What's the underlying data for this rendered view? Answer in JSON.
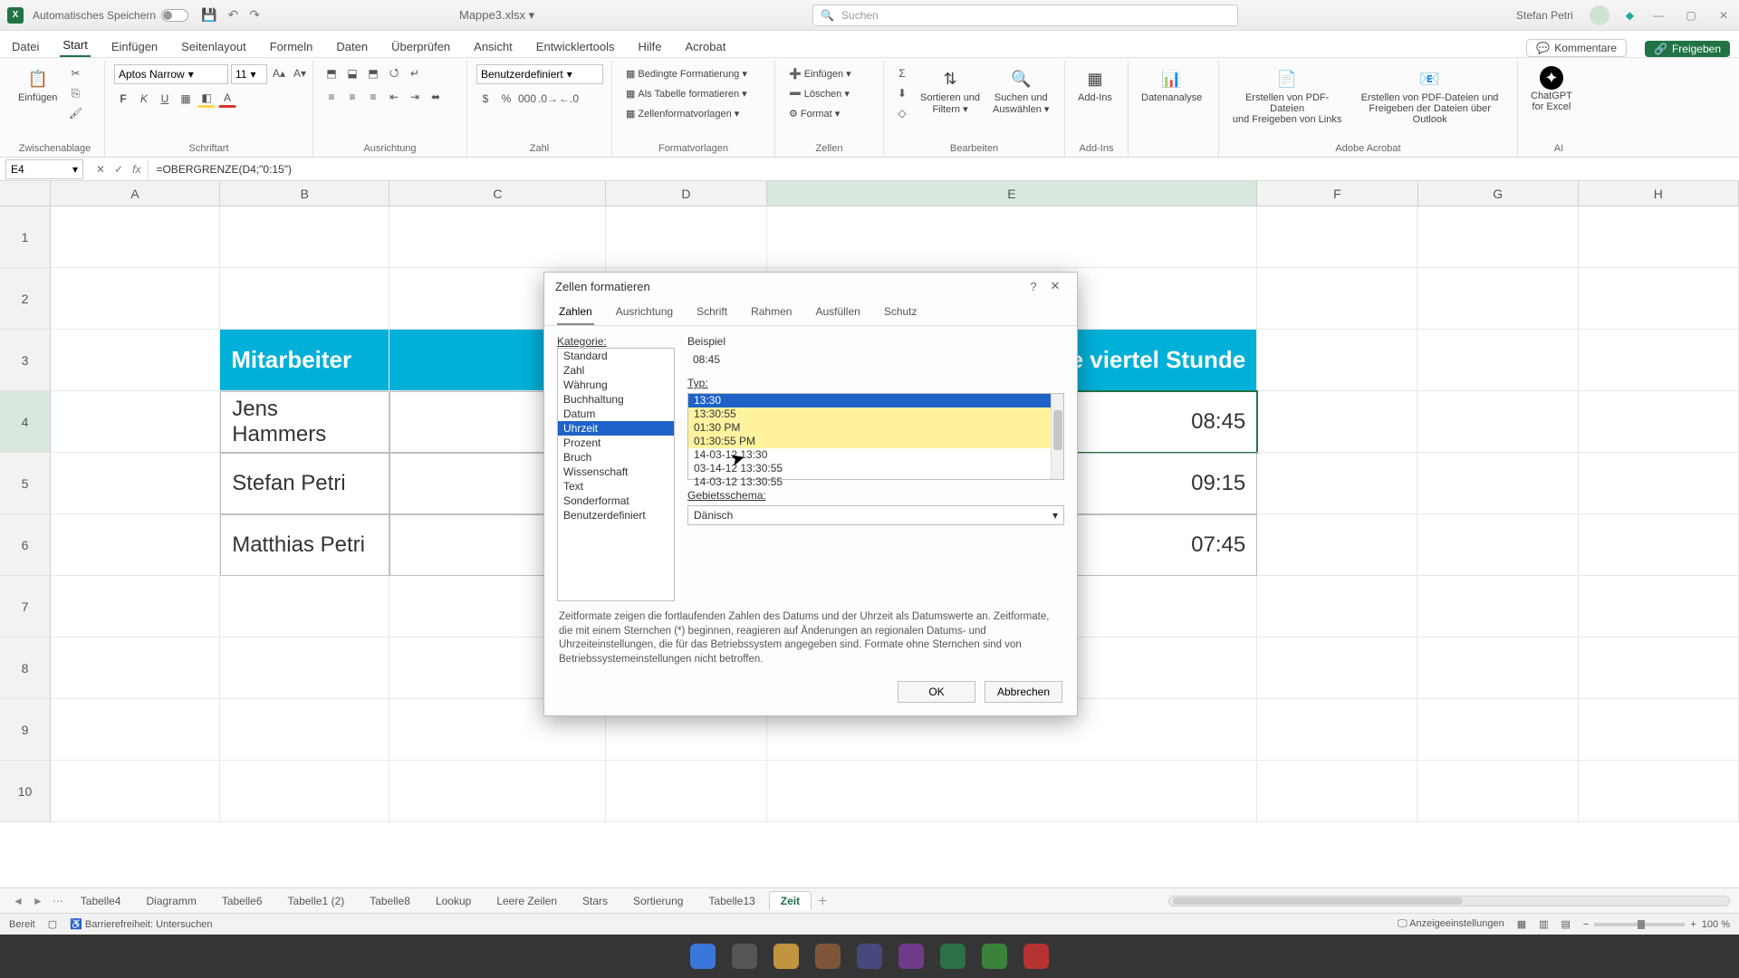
{
  "titlebar": {
    "autosave_label": "Automatisches Speichern",
    "docname": "Mappe3.xlsx ▾",
    "search_placeholder": "Suchen",
    "username": "Stefan Petri"
  },
  "tabs": {
    "file": "Datei",
    "items": [
      "Start",
      "Einfügen",
      "Seitenlayout",
      "Formeln",
      "Daten",
      "Überprüfen",
      "Ansicht",
      "Entwicklertools",
      "Hilfe",
      "Acrobat"
    ],
    "active": "Start",
    "comments": "Kommentare",
    "share": "Freigeben"
  },
  "ribbon": {
    "paste": "Einfügen",
    "clipboard": "Zwischenablage",
    "font_name": "Aptos Narrow",
    "font_size": "11",
    "font_group": "Schriftart",
    "align_group": "Ausrichtung",
    "numfmt": "Benutzerdefiniert",
    "num_group": "Zahl",
    "cond": "Bedingte Formatierung ▾",
    "astable": "Als Tabelle formatieren ▾",
    "cellfmt": "Zellenformatvorlagen ▾",
    "styles_group": "Formatvorlagen",
    "ins": "Einfügen ▾",
    "del": "Löschen ▾",
    "fmt": "Format ▾",
    "cells_group": "Zellen",
    "sort": "Sortieren und\nFiltern ▾",
    "find": "Suchen und\nAuswählen ▾",
    "edit_group": "Bearbeiten",
    "addins": "Add-Ins",
    "addins_group": "Add-Ins",
    "analyze": "Datenanalyse",
    "pdf1": "Erstellen von PDF-Dateien\nund Freigeben von Links",
    "pdf2": "Erstellen von PDF-Dateien und\nFreigeben der Dateien über Outlook",
    "adobe_group": "Adobe Acrobat",
    "gpt": "ChatGPT\nfor Excel",
    "ai_group": "AI"
  },
  "fbar": {
    "name": "E4",
    "formula": "=OBERGRENZE(D4;\"0:15\")"
  },
  "cols": [
    "A",
    "B",
    "C",
    "D",
    "E",
    "F",
    "G",
    "H"
  ],
  "rows": [
    "1",
    "2",
    "3",
    "4",
    "5",
    "6",
    "7",
    "8",
    "9",
    "10"
  ],
  "table": {
    "hdr_b": "Mitarbeiter",
    "hdr_e_tail": "te viertel Stunde",
    "r4_b": "Jens Hammers",
    "r4_e": "08:45",
    "r5_b": "Stefan Petri",
    "r5_e": "09:15",
    "r6_b": "Matthias Petri",
    "r6_e": "07:45"
  },
  "sheets": {
    "items": [
      "Tabelle4",
      "Diagramm",
      "Tabelle6",
      "Tabelle1 (2)",
      "Tabelle8",
      "Lookup",
      "Leere Zeilen",
      "Stars",
      "Sortierung",
      "Tabelle13",
      "Zeit"
    ],
    "active": "Zeit"
  },
  "status": {
    "ready": "Bereit",
    "access": "Barrierefreiheit: Untersuchen",
    "disp": "Anzeigeeinstellungen",
    "zoom": "100 %"
  },
  "dialog": {
    "title": "Zellen formatieren",
    "tabs": [
      "Zahlen",
      "Ausrichtung",
      "Schrift",
      "Rahmen",
      "Ausfüllen",
      "Schutz"
    ],
    "active_tab": "Zahlen",
    "category_label": "Kategorie:",
    "categories": [
      "Standard",
      "Zahl",
      "Währung",
      "Buchhaltung",
      "Datum",
      "Uhrzeit",
      "Prozent",
      "Bruch",
      "Wissenschaft",
      "Text",
      "Sonderformat",
      "Benutzerdefiniert"
    ],
    "selected_category": "Uhrzeit",
    "sample_label": "Beispiel",
    "sample_value": "08:45",
    "type_label": "Typ:",
    "types": [
      "13:30",
      "13:30:55",
      "01:30 PM",
      "01:30:55 PM",
      "14-03-12 13:30",
      "03-14-12 13:30:55",
      "14-03-12 13:30:55"
    ],
    "selected_type": "13:30",
    "locale_label": "Gebietsschema:",
    "locale_value": "Dänisch",
    "description": "Zeitformate zeigen die fortlaufenden Zahlen des Datums und der Uhrzeit als Datumswerte an. Zeitformate, die mit einem Sternchen (*) beginnen, reagieren auf Änderungen an regionalen Datums- und Uhrzeiteinstellungen, die für das Betriebssystem angegeben sind. Formate ohne Sternchen sind von Betriebssystemeinstellungen nicht betroffen.",
    "ok": "OK",
    "cancel": "Abbrechen"
  }
}
